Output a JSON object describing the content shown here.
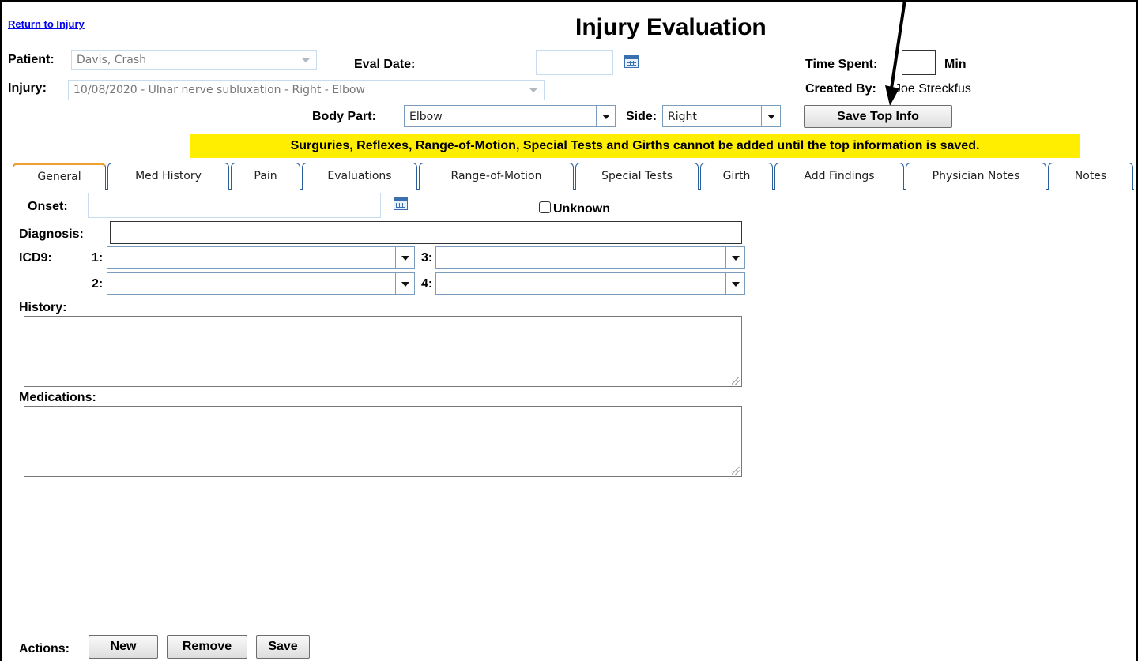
{
  "return_link": "Return to Injury",
  "title": "Injury Evaluation",
  "patient": {
    "label": "Patient:",
    "value": "Davis, Crash"
  },
  "eval_date": {
    "label": "Eval Date:",
    "value": ""
  },
  "time_spent": {
    "label": "Time Spent:",
    "value": "",
    "unit": "Min"
  },
  "created_by": {
    "label": "Created By:",
    "value": "Joe Streckfus"
  },
  "injury": {
    "label": "Injury:",
    "value": "10/08/2020 - Ulnar nerve subluxation - Right - Elbow"
  },
  "body_part": {
    "label": "Body Part:",
    "value": "Elbow"
  },
  "side": {
    "label": "Side:",
    "value": "Right"
  },
  "save_top_label": "Save Top Info",
  "warning": "Surguries, Reflexes, Range-of-Motion, Special Tests and Girths cannot be added until the top information is saved.",
  "tabs": [
    "General",
    "Med History",
    "Pain",
    "Evaluations",
    "Range-of-Motion",
    "Special Tests",
    "Girth",
    "Add Findings",
    "Physician Notes",
    "Notes"
  ],
  "general": {
    "onset_label": "Onset:",
    "onset_value": "",
    "unknown_label": "Unknown",
    "diagnosis_label": "Diagnosis:",
    "diagnosis_value": "",
    "icd9_label": "ICD9:",
    "icd_1": "1:",
    "icd_2": "2:",
    "icd_3": "3:",
    "icd_4": "4:",
    "history_label": "History:",
    "history_value": "",
    "medications_label": "Medications:",
    "medications_value": ""
  },
  "actions": {
    "label": "Actions:",
    "new": "New",
    "remove": "Remove",
    "save": "Save"
  },
  "colors": {
    "warning_bg": "#ffee00",
    "tab_active_top": "#f0a030",
    "link": "#0000ee"
  }
}
